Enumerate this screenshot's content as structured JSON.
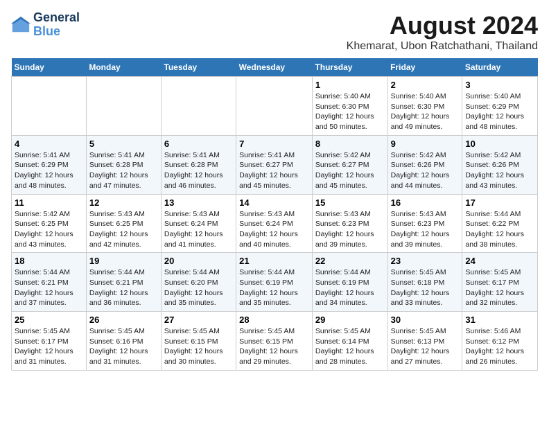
{
  "logo": {
    "line1": "General",
    "line2": "Blue"
  },
  "title": "August 2024",
  "subtitle": "Khemarat, Ubon Ratchathani, Thailand",
  "headers": [
    "Sunday",
    "Monday",
    "Tuesday",
    "Wednesday",
    "Thursday",
    "Friday",
    "Saturday"
  ],
  "weeks": [
    [
      {
        "day": "",
        "info": ""
      },
      {
        "day": "",
        "info": ""
      },
      {
        "day": "",
        "info": ""
      },
      {
        "day": "",
        "info": ""
      },
      {
        "day": "1",
        "sunrise": "5:40 AM",
        "sunset": "6:30 PM",
        "daylight": "12 hours and 50 minutes."
      },
      {
        "day": "2",
        "sunrise": "5:40 AM",
        "sunset": "6:30 PM",
        "daylight": "12 hours and 49 minutes."
      },
      {
        "day": "3",
        "sunrise": "5:40 AM",
        "sunset": "6:29 PM",
        "daylight": "12 hours and 48 minutes."
      }
    ],
    [
      {
        "day": "4",
        "sunrise": "5:41 AM",
        "sunset": "6:29 PM",
        "daylight": "12 hours and 48 minutes."
      },
      {
        "day": "5",
        "sunrise": "5:41 AM",
        "sunset": "6:28 PM",
        "daylight": "12 hours and 47 minutes."
      },
      {
        "day": "6",
        "sunrise": "5:41 AM",
        "sunset": "6:28 PM",
        "daylight": "12 hours and 46 minutes."
      },
      {
        "day": "7",
        "sunrise": "5:41 AM",
        "sunset": "6:27 PM",
        "daylight": "12 hours and 45 minutes."
      },
      {
        "day": "8",
        "sunrise": "5:42 AM",
        "sunset": "6:27 PM",
        "daylight": "12 hours and 45 minutes."
      },
      {
        "day": "9",
        "sunrise": "5:42 AM",
        "sunset": "6:26 PM",
        "daylight": "12 hours and 44 minutes."
      },
      {
        "day": "10",
        "sunrise": "5:42 AM",
        "sunset": "6:26 PM",
        "daylight": "12 hours and 43 minutes."
      }
    ],
    [
      {
        "day": "11",
        "sunrise": "5:42 AM",
        "sunset": "6:25 PM",
        "daylight": "12 hours and 43 minutes."
      },
      {
        "day": "12",
        "sunrise": "5:43 AM",
        "sunset": "6:25 PM",
        "daylight": "12 hours and 42 minutes."
      },
      {
        "day": "13",
        "sunrise": "5:43 AM",
        "sunset": "6:24 PM",
        "daylight": "12 hours and 41 minutes."
      },
      {
        "day": "14",
        "sunrise": "5:43 AM",
        "sunset": "6:24 PM",
        "daylight": "12 hours and 40 minutes."
      },
      {
        "day": "15",
        "sunrise": "5:43 AM",
        "sunset": "6:23 PM",
        "daylight": "12 hours and 39 minutes."
      },
      {
        "day": "16",
        "sunrise": "5:43 AM",
        "sunset": "6:23 PM",
        "daylight": "12 hours and 39 minutes."
      },
      {
        "day": "17",
        "sunrise": "5:44 AM",
        "sunset": "6:22 PM",
        "daylight": "12 hours and 38 minutes."
      }
    ],
    [
      {
        "day": "18",
        "sunrise": "5:44 AM",
        "sunset": "6:21 PM",
        "daylight": "12 hours and 37 minutes."
      },
      {
        "day": "19",
        "sunrise": "5:44 AM",
        "sunset": "6:21 PM",
        "daylight": "12 hours and 36 minutes."
      },
      {
        "day": "20",
        "sunrise": "5:44 AM",
        "sunset": "6:20 PM",
        "daylight": "12 hours and 35 minutes."
      },
      {
        "day": "21",
        "sunrise": "5:44 AM",
        "sunset": "6:19 PM",
        "daylight": "12 hours and 35 minutes."
      },
      {
        "day": "22",
        "sunrise": "5:44 AM",
        "sunset": "6:19 PM",
        "daylight": "12 hours and 34 minutes."
      },
      {
        "day": "23",
        "sunrise": "5:45 AM",
        "sunset": "6:18 PM",
        "daylight": "12 hours and 33 minutes."
      },
      {
        "day": "24",
        "sunrise": "5:45 AM",
        "sunset": "6:17 PM",
        "daylight": "12 hours and 32 minutes."
      }
    ],
    [
      {
        "day": "25",
        "sunrise": "5:45 AM",
        "sunset": "6:17 PM",
        "daylight": "12 hours and 31 minutes."
      },
      {
        "day": "26",
        "sunrise": "5:45 AM",
        "sunset": "6:16 PM",
        "daylight": "12 hours and 31 minutes."
      },
      {
        "day": "27",
        "sunrise": "5:45 AM",
        "sunset": "6:15 PM",
        "daylight": "12 hours and 30 minutes."
      },
      {
        "day": "28",
        "sunrise": "5:45 AM",
        "sunset": "6:15 PM",
        "daylight": "12 hours and 29 minutes."
      },
      {
        "day": "29",
        "sunrise": "5:45 AM",
        "sunset": "6:14 PM",
        "daylight": "12 hours and 28 minutes."
      },
      {
        "day": "30",
        "sunrise": "5:45 AM",
        "sunset": "6:13 PM",
        "daylight": "12 hours and 27 minutes."
      },
      {
        "day": "31",
        "sunrise": "5:46 AM",
        "sunset": "6:12 PM",
        "daylight": "12 hours and 26 minutes."
      }
    ]
  ]
}
